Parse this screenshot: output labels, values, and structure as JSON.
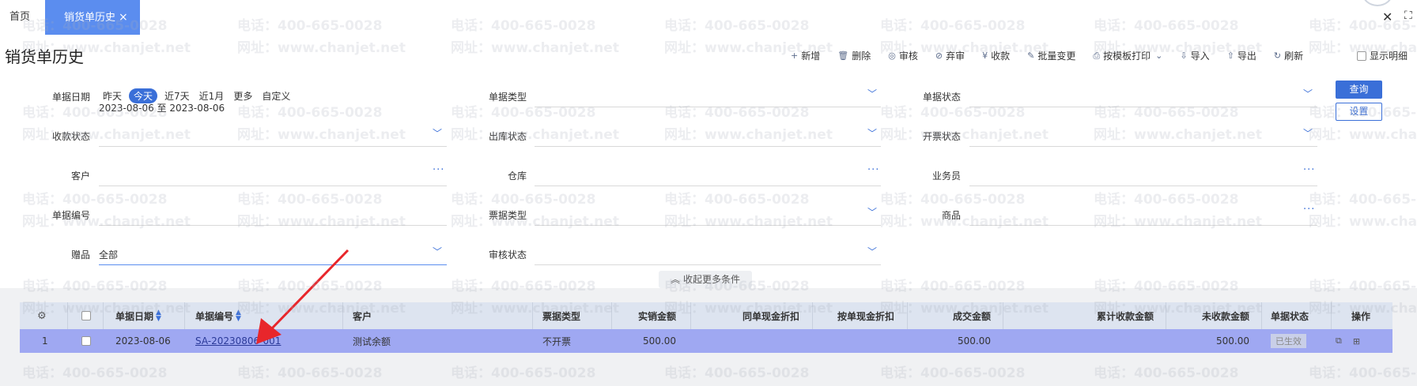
{
  "tabs": {
    "home": "首页",
    "active": "销货单历史",
    "close": "×"
  },
  "window": {
    "close": "✕",
    "maximize": "⛶"
  },
  "page_title": "销货单历史",
  "toolbar": {
    "add": "新增",
    "delete": "删除",
    "review": "审核",
    "unreview": "弃审",
    "receive": "收款",
    "batch_change": "批量变更",
    "print": "按模板打印",
    "import": "导入",
    "export": "导出",
    "refresh": "刷新",
    "show_detail": "显示明细"
  },
  "filters": {
    "doc_date_label": "单据日期",
    "date_pills": [
      "昨天",
      "今天",
      "近7天",
      "近1月",
      "更多",
      "自定义"
    ],
    "date_active": "今天",
    "date_range": "2023-08-06 至 2023-08-06",
    "doc_type_label": "单据类型",
    "doc_status_label": "单据状态",
    "receipt_status_label": "收款状态",
    "outbound_status_label": "出库状态",
    "invoice_status_label": "开票状态",
    "customer_label": "客户",
    "warehouse_label": "仓库",
    "salesperson_label": "业务员",
    "doc_no_label": "单据编号",
    "ticket_type_label": "票据类型",
    "goods_label": "商品",
    "gift_label": "赠品",
    "gift_value": "全部",
    "audit_status_label": "审核状态",
    "query_button": "查询",
    "settings_button": "设置",
    "collapse_button": "收起更多条件"
  },
  "table": {
    "headers": {
      "doc_date": "单据日期",
      "doc_no": "单据编号",
      "customer": "客户",
      "ticket_type": "票据类型",
      "actual_amount": "实销金额",
      "same_cash_discount": "同单现金折扣",
      "per_cash_discount": "按单现金折扣",
      "deal_amount": "成交金额",
      "cum_received": "累计收款金额",
      "unreceived": "未收款金额",
      "status": "单据状态",
      "operation": "操作"
    },
    "rows": [
      {
        "index": "1",
        "doc_date": "2023-08-06",
        "doc_no": "SA-20230806-001",
        "customer": "测试余额",
        "ticket_type": "不开票",
        "actual_amount": "500.00",
        "same_cash_discount": "",
        "per_cash_discount": "",
        "deal_amount": "500.00",
        "cum_received": "",
        "unreceived": "500.00",
        "status": "已生效"
      }
    ]
  },
  "watermark": {
    "phone": "电话：400-665-0028",
    "site": "网址：www.chanjet.net"
  },
  "colors": {
    "accent": "#3a6fd8",
    "tab_active": "#5b8def",
    "row_selected": "#9fa8f2",
    "arrow": "#e8262b"
  }
}
